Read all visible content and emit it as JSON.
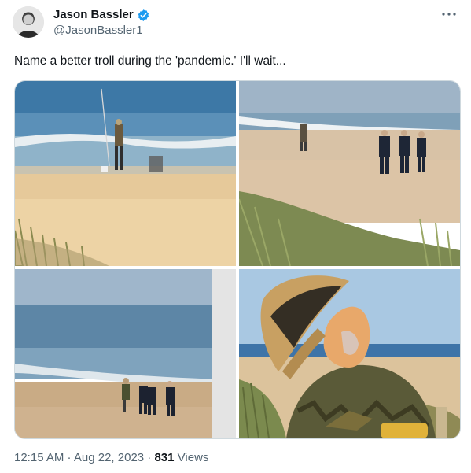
{
  "tweet": {
    "author_name": "Jason Bassler",
    "author_handle": "@JasonBassler1",
    "text": "Name a better troll during the 'pandemic.' I'll wait...",
    "timestamp": "12:15 AM · Aug 22, 2023 · ",
    "views_count": "831",
    "views_label": " Views"
  },
  "icons": {
    "verified": "verified-badge-icon",
    "more": "more-horizontal-icon"
  },
  "colors": {
    "verified_blue": "#1d9bf0",
    "text_primary": "#0f1419",
    "text_secondary": "#536471"
  }
}
